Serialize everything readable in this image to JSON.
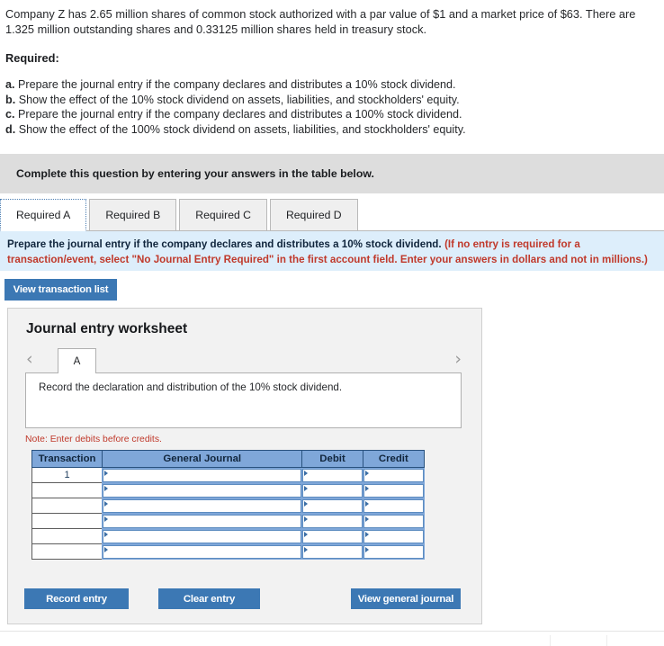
{
  "question": {
    "stem": "Company Z has 2.65 million shares of common stock authorized with a par value of $1 and a market price of $63. There are 1.325 million outstanding shares and 0.33125 million shares held in treasury stock.",
    "required_heading": "Required:",
    "required_items": [
      {
        "letter": "a.",
        "text": "Prepare the journal entry if the company declares and distributes a 10% stock dividend."
      },
      {
        "letter": "b.",
        "text": "Show the effect of the 10% stock dividend on assets, liabilities, and stockholders' equity."
      },
      {
        "letter": "c.",
        "text": "Prepare the journal entry if the company declares and distributes a 100% stock dividend."
      },
      {
        "letter": "d.",
        "text": "Show the effect of the 100% stock dividend on assets, liabilities, and stockholders' equity."
      }
    ]
  },
  "gray_banner": {
    "text": "Complete this question by entering your answers in the table below."
  },
  "tabs": [
    {
      "label": "Required A",
      "active": true
    },
    {
      "label": "Required B",
      "active": false
    },
    {
      "label": "Required C",
      "active": false
    },
    {
      "label": "Required D",
      "active": false
    }
  ],
  "blue_bar": {
    "primary": "Prepare the journal entry if the company declares and distributes a 10% stock dividend.",
    "secondary": "(If no entry is required for a transaction/event, select \"No Journal Entry Required\" in the first account field. Enter your answers in dollars and not in millions.)"
  },
  "buttons": {
    "view_transaction_list": "View transaction list",
    "record_entry": "Record entry",
    "clear_entry": "Clear entry",
    "view_general_journal": "View general journal"
  },
  "worksheet": {
    "title": "Journal entry worksheet",
    "subtab_label": "A",
    "prev_arrow_icon": "chevron-left-icon",
    "next_arrow_icon": "chevron-right-icon",
    "description": "Record the declaration and distribution of the 10% stock dividend.",
    "note": "Note: Enter debits before credits."
  },
  "journal_table": {
    "headers": [
      "Transaction",
      "General Journal",
      "Debit",
      "Credit"
    ],
    "rows": [
      {
        "transaction": "1",
        "general_journal": "",
        "debit": "",
        "credit": ""
      },
      {
        "transaction": "",
        "general_journal": "",
        "debit": "",
        "credit": ""
      },
      {
        "transaction": "",
        "general_journal": "",
        "debit": "",
        "credit": ""
      },
      {
        "transaction": "",
        "general_journal": "",
        "debit": "",
        "credit": ""
      },
      {
        "transaction": "",
        "general_journal": "",
        "debit": "",
        "credit": ""
      },
      {
        "transaction": "",
        "general_journal": "",
        "debit": "",
        "credit": ""
      }
    ]
  },
  "colors": {
    "accent_blue": "#3c78b4",
    "table_header_blue": "#7fa7d9",
    "info_bar_blue": "#ddeefb",
    "banner_gray": "#dddddd",
    "warning_red": "#c0392b"
  }
}
